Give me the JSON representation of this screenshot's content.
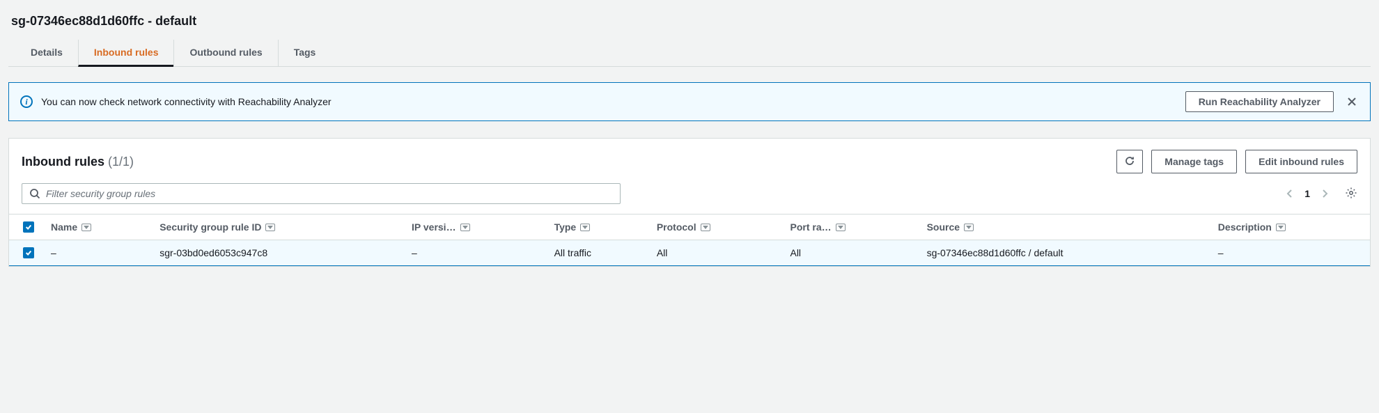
{
  "page_title": "sg-07346ec88d1d60ffc - default",
  "tabs": {
    "details": "Details",
    "inbound": "Inbound rules",
    "outbound": "Outbound rules",
    "tags": "Tags"
  },
  "notice": {
    "text": "You can now check network connectivity with Reachability Analyzer",
    "button": "Run Reachability Analyzer"
  },
  "panel": {
    "title": "Inbound rules",
    "count": "(1/1)",
    "manage_tags": "Manage tags",
    "edit_rules": "Edit inbound rules",
    "filter_placeholder": "Filter security group rules",
    "page_number": "1"
  },
  "columns": {
    "name": "Name",
    "sgrid": "Security group rule ID",
    "ipver": "IP versi…",
    "type": "Type",
    "protocol": "Protocol",
    "port": "Port ra…",
    "source": "Source",
    "desc": "Description"
  },
  "rows": [
    {
      "name": "–",
      "sgrid": "sgr-03bd0ed6053c947c8",
      "ipver": "–",
      "type": "All traffic",
      "protocol": "All",
      "port": "All",
      "source": "sg-07346ec88d1d60ffc / default",
      "desc": "–"
    }
  ]
}
